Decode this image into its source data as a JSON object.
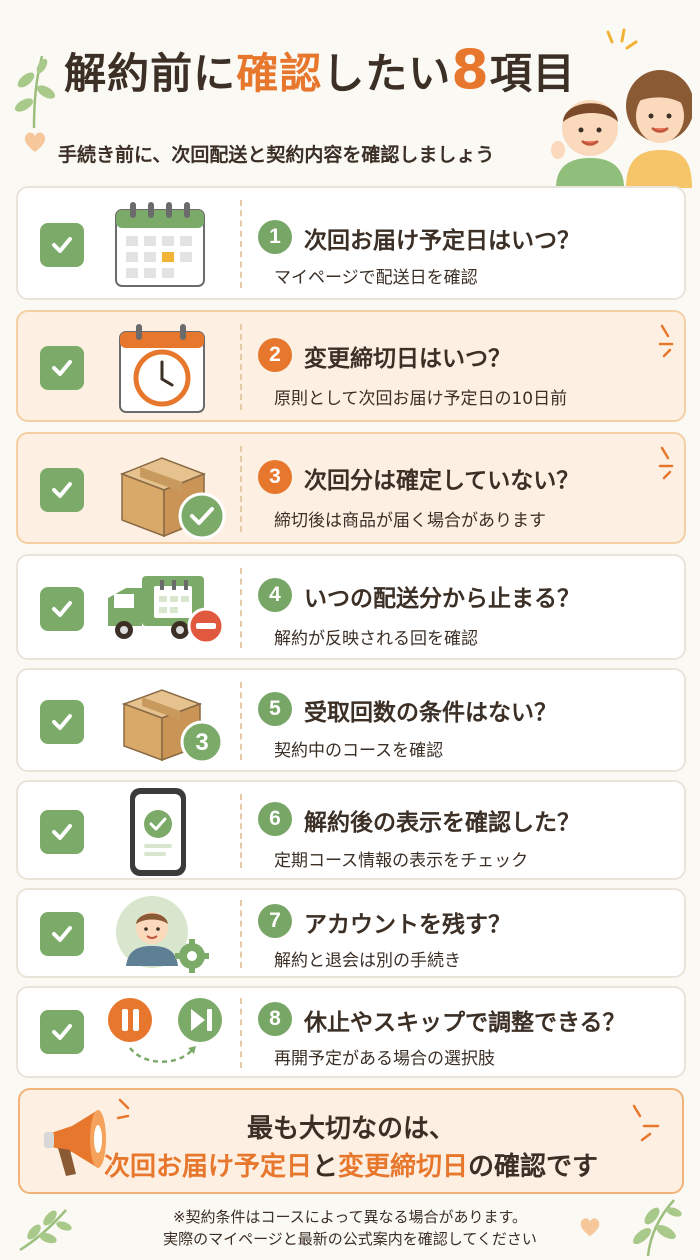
{
  "header": {
    "title_a": "解約前に",
    "title_b": "確認",
    "title_c": "したい",
    "title_num": "8",
    "title_d": "項目",
    "subtitle": "手続き前に、次回配送と契約内容を確認しましょう"
  },
  "items": [
    {
      "num": "1",
      "title": "次回お届け予定日はいつ？",
      "desc": "マイページで配送日を確認",
      "icon": "calendar-icon",
      "highlight": false
    },
    {
      "num": "2",
      "title": "変更締切日はいつ？",
      "desc": "原則として次回お届け予定日の10日前",
      "icon": "clock-calendar-icon",
      "highlight": true
    },
    {
      "num": "3",
      "title": "次回分は確定していない？",
      "desc": "締切後は商品が届く場合があります",
      "icon": "box-check-icon",
      "highlight": true
    },
    {
      "num": "4",
      "title": "いつの配送分から止まる？",
      "desc": "解約が反映される回を確認",
      "icon": "truck-stop-icon",
      "highlight": false
    },
    {
      "num": "5",
      "title": "受取回数の条件はない？",
      "desc": "契約中のコースを確認",
      "icon": "box-count-icon",
      "highlight": false,
      "badge": "3"
    },
    {
      "num": "6",
      "title": "解約後の表示を確認した？",
      "desc": "定期コース情報の表示をチェック",
      "icon": "phone-check-icon",
      "highlight": false
    },
    {
      "num": "7",
      "title": "アカウントを残す？",
      "desc": "解約と退会は別の手続き",
      "icon": "account-gear-icon",
      "highlight": false
    },
    {
      "num": "8",
      "title": "休止やスキップで調整できる？",
      "desc": "再開予定がある場合の選択肢",
      "icon": "pause-skip-icon",
      "highlight": false
    }
  ],
  "banner": {
    "line1": "最も大切なのは、",
    "line2_a": "次回お届け予定日",
    "line2_b": "と",
    "line2_c": "変更締切日",
    "line2_d": "の確認です"
  },
  "note": {
    "line1": "※契約条件はコースによって異なる場合があります。",
    "line2": "実際のマイページと最新の公式案内を確認してください"
  },
  "colors": {
    "accent": "#e8772e",
    "green": "#7cab69",
    "text": "#3b2f26"
  }
}
